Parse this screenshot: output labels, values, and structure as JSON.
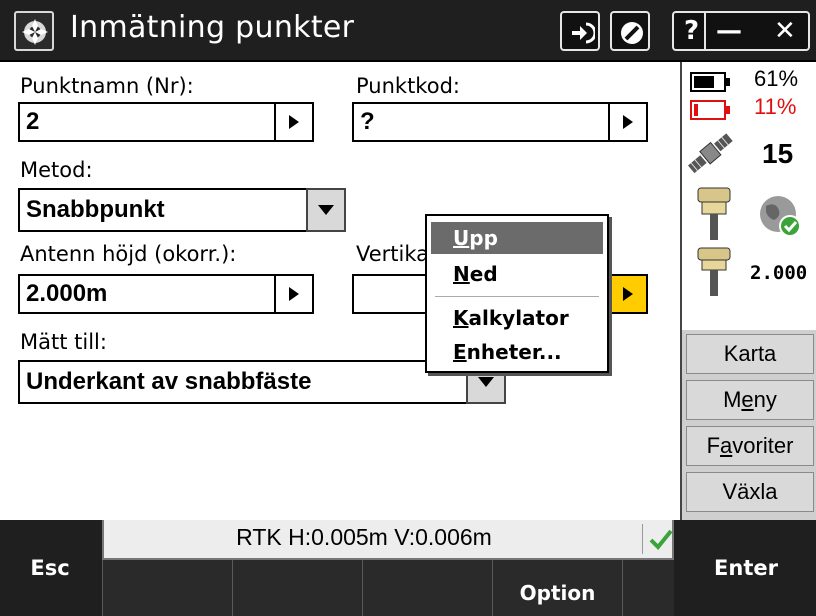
{
  "window": {
    "title": "Inmätning punkter",
    "controls": {
      "help": "?",
      "minimize": "—",
      "close": "✕"
    }
  },
  "form": {
    "point_name": {
      "label": "Punktnamn (Nr):",
      "value": "2"
    },
    "point_code": {
      "label": "Punktkod:",
      "value": "?"
    },
    "method": {
      "label": "Metod:",
      "value": "Snabbpunkt"
    },
    "antenna_height": {
      "label": "Antenn höjd (okorr.):",
      "value": "2.000m"
    },
    "vertical": {
      "label": "Vertika",
      "value": ""
    },
    "measured_to": {
      "label": "Mätt till:",
      "value": "Underkant av snabbfäste"
    }
  },
  "popup_menu": {
    "items": [
      {
        "first": "U",
        "rest": "pp",
        "selected": true
      },
      {
        "first": "N",
        "rest": "ed",
        "selected": false
      },
      {
        "first": "K",
        "rest": "alkylator",
        "selected": false
      },
      {
        "first": "E",
        "rest": "nheter...",
        "selected": false
      }
    ]
  },
  "status_panel": {
    "controller_battery": "61%",
    "receiver_battery": "11%",
    "satellites": "15",
    "antenna_height_display": "2.000",
    "colors": {
      "low_battery": "#e01010",
      "ok_check": "#3aa43a",
      "accent_yellow": "#ffcc00"
    },
    "icons": [
      "battery-icon",
      "battery-low-icon",
      "satellite-icon",
      "gnss-receiver-icon",
      "globe-check-icon",
      "antenna-icon"
    ]
  },
  "side_buttons": [
    {
      "pre": "",
      "u": "",
      "post": "Karta"
    },
    {
      "pre": "M",
      "u": "e",
      "post": "ny"
    },
    {
      "pre": "F",
      "u": "a",
      "post": "voriter"
    },
    {
      "pre": "",
      "u": "",
      "post": "Växla"
    }
  ],
  "bottom_bar": {
    "rtk_status": "RTK H:0.005m V:0.006m",
    "esc_label": "Esc",
    "option_label": "Option",
    "enter_label": "Enter"
  }
}
